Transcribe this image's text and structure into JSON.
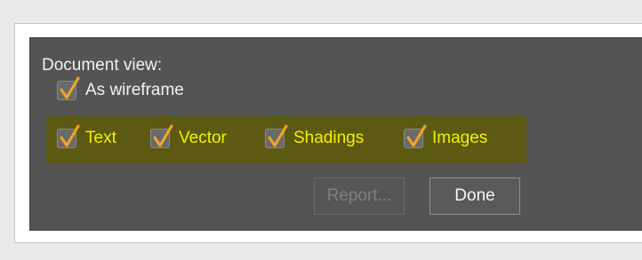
{
  "dialog": {
    "heading": "Document view:",
    "wireframe": {
      "label": "As wireframe",
      "checked": true
    },
    "options": [
      {
        "label": "Text",
        "checked": true
      },
      {
        "label": "Vector",
        "checked": true
      },
      {
        "label": "Shadings",
        "checked": true
      },
      {
        "label": "Images",
        "checked": true
      }
    ],
    "buttons": {
      "report": "Report...",
      "done": "Done"
    }
  },
  "colors": {
    "dialog_bg": "#545454",
    "checkmark": "#f5a623",
    "highlight_bg": "#5c5a12",
    "highlight_text": "#f4f000"
  }
}
